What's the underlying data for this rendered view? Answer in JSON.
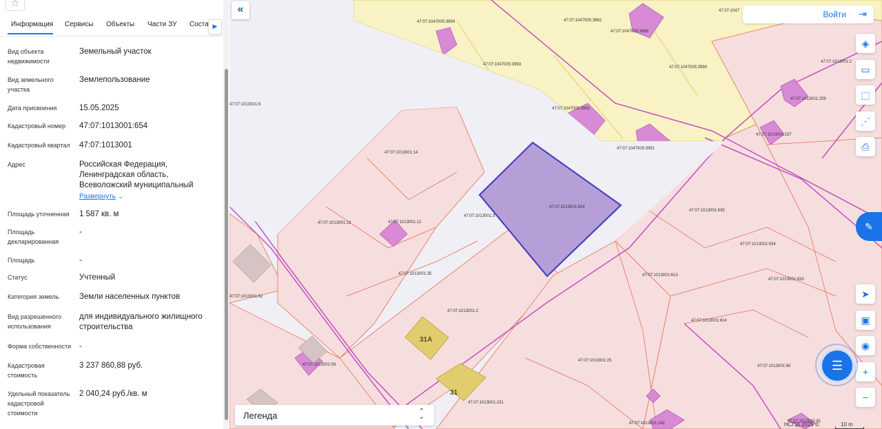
{
  "app": {
    "star_label": "☆",
    "login_label": "Войти"
  },
  "tabs": [
    {
      "label": "Информация",
      "active": true
    },
    {
      "label": "Сервисы"
    },
    {
      "label": "Объекты"
    },
    {
      "label": "Части ЗУ"
    },
    {
      "label": "Соста"
    }
  ],
  "properties": [
    {
      "label": "Вид объекта недвижимости",
      "value": "Земельный участок"
    },
    {
      "label": "Вид земельного участка",
      "value": "Землепользование"
    },
    {
      "label": "Дата присвоения",
      "value": "15.05.2025"
    },
    {
      "label": "Кадастровый номер",
      "value": "47:07:1013001:654"
    },
    {
      "label": "Кадастровый квартал",
      "value": "47:07:1013001"
    },
    {
      "label": "Адрес",
      "value": "Российская Федерация, Ленинградская область, Всеволожский муниципальный",
      "expand": "Развернуть"
    },
    {
      "label": "Площадь уточненная",
      "value": "1 587 кв. м"
    },
    {
      "label": "Площадь декларированная",
      "value": "-"
    },
    {
      "label": "Площадь",
      "value": "-"
    },
    {
      "label": "Статус",
      "value": "Учтенный"
    },
    {
      "label": "Категория земель",
      "value": "Земли населенных пунктов"
    },
    {
      "label": "Вид разрешенного использования",
      "value": "для индивидуального жилищного строительства"
    },
    {
      "label": "Форма собственности",
      "value": "-"
    },
    {
      "label": "Кадастровая стоимость",
      "value": "3 237 860,88 руб."
    },
    {
      "label": "Удельный показатель кадастровой стоимости",
      "value": "2 040,24 руб./кв. м"
    }
  ],
  "map": {
    "legend_label": "Легенда",
    "attribution": "НСПД 2025 ©",
    "scale_label": "10 m",
    "selected_parcel": "47:07:1013001:654",
    "parcel_labels": [
      "47:07:1047005:3994",
      "47:07:1047005:3982",
      "47:07:1047005:3988",
      "47:07:1047005:3993",
      "47:07:1047005:3990",
      "47:07:1047005:3992",
      "47:07:1047005:3991",
      "47:07:1013001:8",
      "47:07:1013001:14",
      "47:07:1013001:13",
      "47:07:1013001:12",
      "47:07:1013001:35",
      "47:07:1013001:2",
      "47:07:1013001:62",
      "47:07:1013001:59",
      "47:07:1013001:231",
      "47:07:1013001:25",
      "47:07:1013001:635",
      "47:07:1013001:634",
      "47:07:1013001:613",
      "47:07:1013001:633",
      "47:07:1013001:614",
      "47:07:1013001:60",
      "47:07:1013001:259",
      "47:07:1013001:237",
      "47:07:1013001:242",
      "47:07:1013001:61",
      "47:07:1013001:2",
      "47:07:1013001:3",
      "47:07:1047"
    ],
    "house_numbers": [
      "31А",
      "31"
    ],
    "colors": {
      "selected_fill": "#b59fd6",
      "selected_stroke": "#4a3fc4",
      "parcel_fill": "#f7dede",
      "parcel_stroke": "#e8846f",
      "building": "#d98ad6",
      "yellow_zone": "#f8f2c4",
      "accent": "#1a73e8"
    }
  }
}
